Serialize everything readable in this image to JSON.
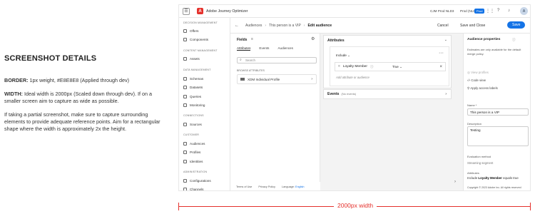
{
  "details": {
    "heading": "SCREENSHOT DETAILS",
    "border_label": "BORDER:",
    "border_text": " 1px weight, #E8E8E8 (Applied through dev)",
    "width_label": "WIDTH:",
    "width_text": " Ideal width is 2000px (Scaled down through dev). If on a smaller screen aim to capture as wide as possible.",
    "partial_text": "If taking a partial screenshot, make sure to capture surrounding elements to provide adequate reference points. Aim for a rectangular shape where the width is approximately 2x the height."
  },
  "topbar": {
    "app_name": "Adobe Journey Optimizer",
    "org": "CJM Prod NLD3",
    "sandbox": "Prod (NLD2)",
    "prod_badge": "Prod",
    "avatar": "A"
  },
  "sidenav": {
    "sections": [
      {
        "label": "DECISION MANAGEMENT",
        "items": [
          "Offers",
          "Components"
        ]
      },
      {
        "label": "CONTENT MANAGEMENT",
        "items": [
          "Assets"
        ]
      },
      {
        "label": "DATA MANAGEMENT",
        "items": [
          "Schemas",
          "Datasets",
          "Queries",
          "Monitoring"
        ]
      },
      {
        "label": "CONNECTIONS",
        "items": [
          "Sources"
        ]
      },
      {
        "label": "CUSTOMER",
        "items": [
          "Audiences",
          "Profiles",
          "Identities"
        ]
      },
      {
        "label": "ADMINISTRATION",
        "items": [
          "Configurations",
          "Channels"
        ]
      }
    ]
  },
  "breadcrumb": {
    "back": "←",
    "items": [
      "Audiences",
      "This person is a VIP"
    ],
    "current": "Edit audience",
    "cancel": "Cancel",
    "save_close": "Save and Close",
    "save": "Save"
  },
  "fields": {
    "title": "Fields",
    "tabs": [
      "Attributes",
      "Events",
      "Audiences"
    ],
    "search_placeholder": "Search",
    "browse_label": "BROWSE ATTRIBUTES",
    "xdm_item": "XDM Individual Profile",
    "footer": [
      "Terms of Use",
      "Privacy Policy",
      "Language:"
    ],
    "language": "English"
  },
  "attributes": {
    "title": "Attributes",
    "include": "Include",
    "attr_name": "Loyalty Member",
    "operator": "True",
    "hint": "Add attribute or audience"
  },
  "events": {
    "title": "Events",
    "sub": "(No events)"
  },
  "props": {
    "title": "Audience properties",
    "note": "Estimates are only available for the default merge policy.",
    "actions": [
      "View profiles",
      "Code view",
      "Apply access labels"
    ],
    "name_label": "Name *",
    "name_value": "This person is a VIP",
    "desc_label": "Description",
    "desc_value": "Testing",
    "eval_label": "Evaluation method",
    "eval_value": "Streaming segment",
    "attrs_label": "Attributes",
    "attrs_prefix": "Include",
    "attrs_name": "Loyalty Member",
    "attrs_suffix": "equals true"
  },
  "copyright": "Copyright © 2023 Adobe Inc.  All rights reserved",
  "dimension_label": "2000px width",
  "colors": {
    "accent": "#1473e6",
    "brand": "#e5312c",
    "border": "#e8e8e8"
  }
}
